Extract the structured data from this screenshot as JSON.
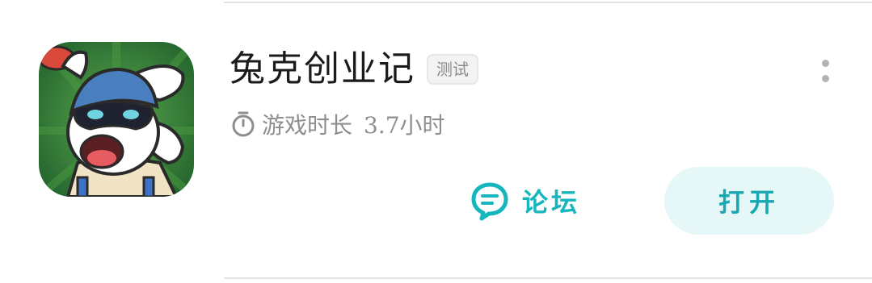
{
  "app": {
    "title": "兔克创业记",
    "tag": "测试",
    "playtime_label": "游戏时长",
    "playtime_value": "3.7小时"
  },
  "actions": {
    "forum_label": "论坛",
    "open_label": "打开"
  },
  "icons": {
    "app_icon": "rabbit-character-app-icon",
    "more": "more-vertical-icon",
    "timer": "stopwatch-icon",
    "forum": "chat-bubble-icon"
  },
  "colors": {
    "accent": "#16b6be",
    "open_button_bg": "#e6f7f8",
    "secondary_text": "#8e8e8e",
    "icon_bg_green": "#2f7a36"
  }
}
